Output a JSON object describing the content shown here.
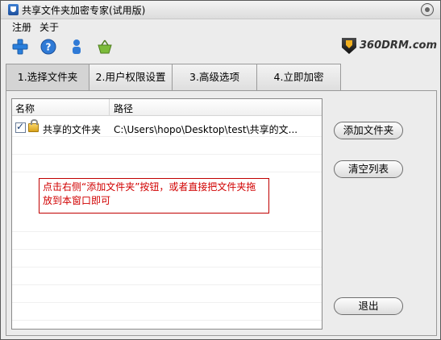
{
  "window": {
    "title": "共享文件夹加密专家(试用版)"
  },
  "menu": {
    "items": [
      "注册",
      "关于"
    ]
  },
  "toolbar": {
    "icons": [
      "plus-icon",
      "help-icon",
      "user-icon",
      "basket-icon"
    ]
  },
  "logo": {
    "text": "360DRM.com"
  },
  "tabs": [
    "1.选择文件夹",
    "2.用户权限设置",
    "3.高级选项",
    "4.立即加密"
  ],
  "list": {
    "columns": [
      "名称",
      "路径"
    ],
    "rows": [
      {
        "checked": true,
        "name": "共享的文件夹",
        "path": "C:\\Users\\hopo\\Desktop\\test\\共享的文..."
      }
    ]
  },
  "hint": {
    "text": "点击右侧“添加文件夹”按钮，或者直接把文件夹拖放到本窗口即可"
  },
  "buttons": {
    "add_folder": "添加文件夹",
    "clear_list": "清空列表",
    "exit": "退出"
  },
  "colors": {
    "hint_border": "#c00000",
    "hint_text": "#d10000"
  }
}
